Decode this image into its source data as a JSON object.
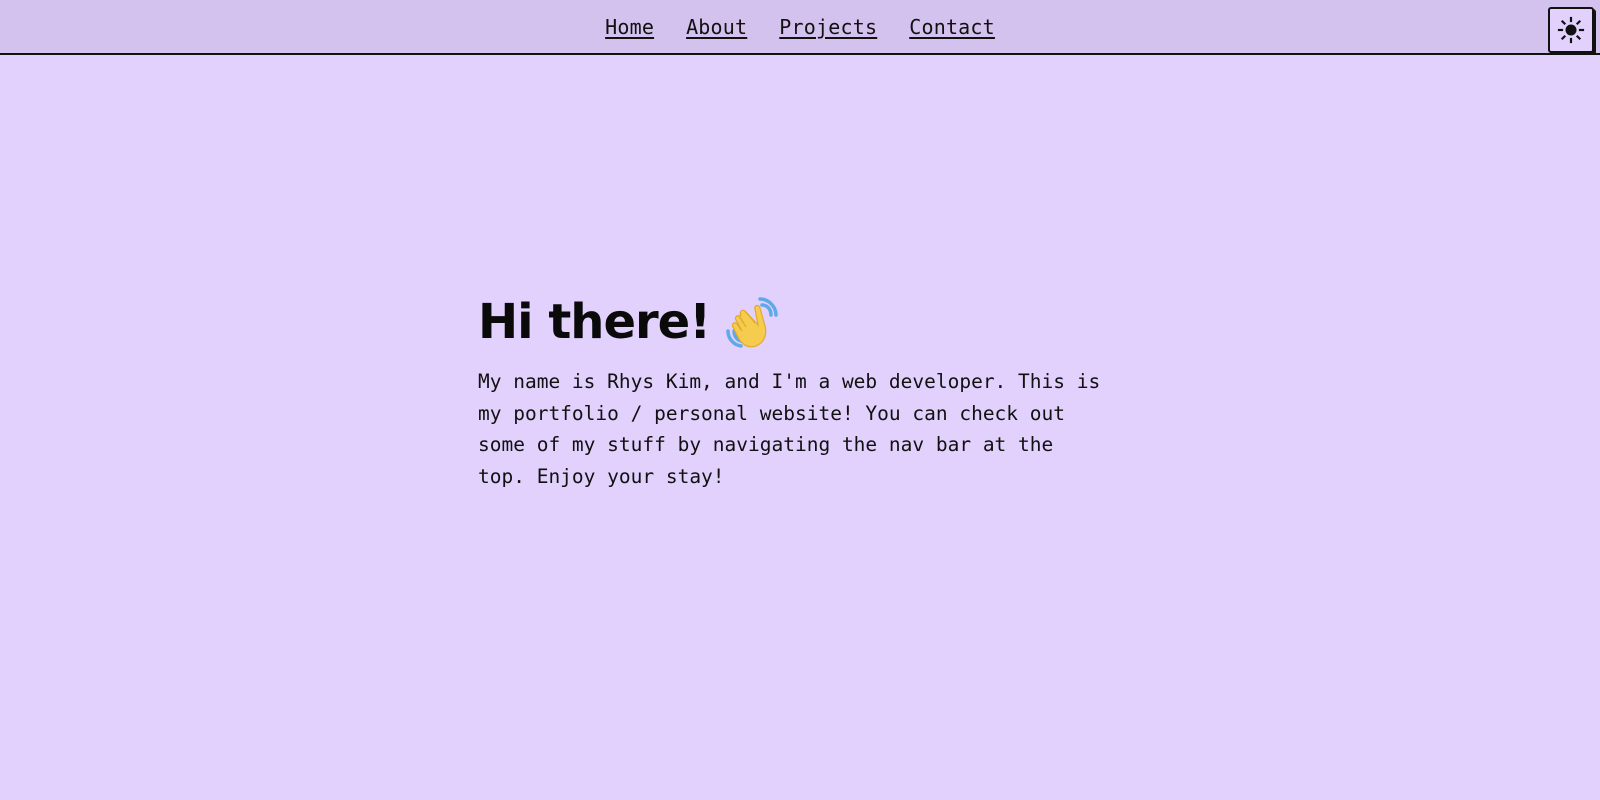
{
  "nav": {
    "links": [
      {
        "label": "Home"
      },
      {
        "label": "About"
      },
      {
        "label": "Projects"
      },
      {
        "label": "Contact"
      }
    ],
    "theme_toggle_icon": "sun-icon"
  },
  "hero": {
    "title": "Hi there!",
    "title_icon": "waving-hand-icon",
    "body": "My name is Rhys Kim, and I'm a web developer. This is my portfolio / personal website! You can check out some of my stuff by navigating the nav bar at the top. Enjoy your stay!"
  },
  "colors": {
    "page_background": "#e1d1fc",
    "navbar_background": "#d3c1ee",
    "text": "#111111",
    "wave_hand": "#f6cc4e",
    "wave_motion_lines": "#5ea9e8"
  }
}
